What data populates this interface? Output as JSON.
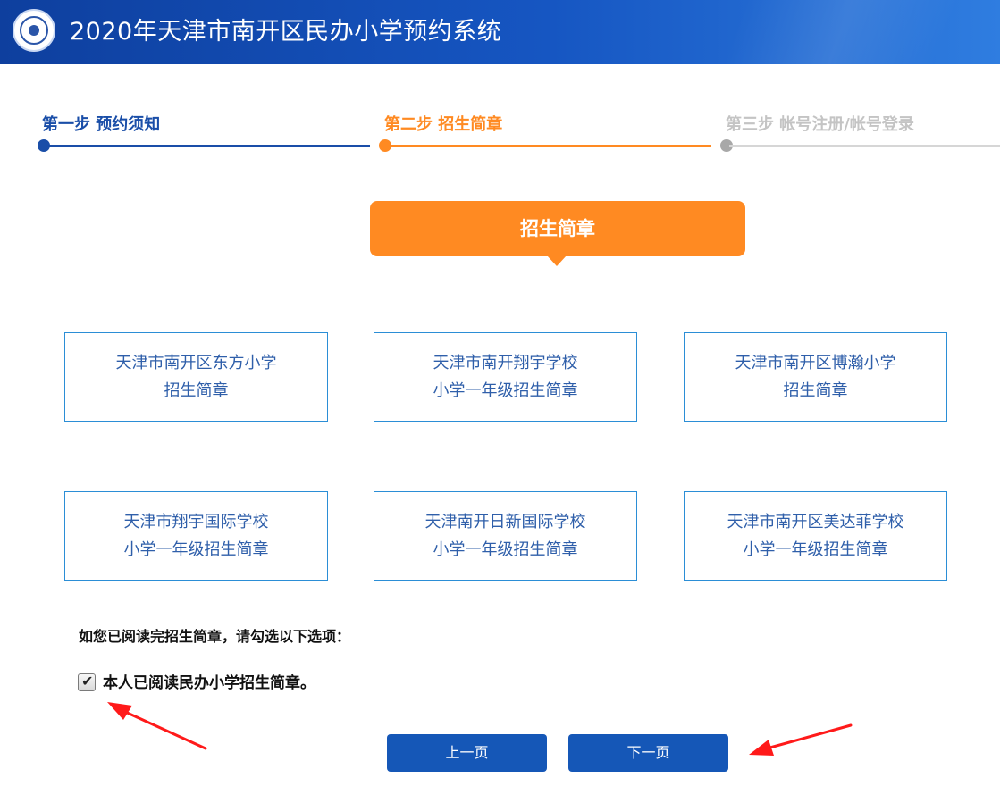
{
  "header": {
    "title": "2020年天津市南开区民办小学预约系统"
  },
  "steps": [
    {
      "label": "第一步 预约须知",
      "state": "done",
      "color": "#1a4ea8"
    },
    {
      "label": "第二步 招生简章",
      "state": "active",
      "color": "#ff8a22"
    },
    {
      "label": "第三步 帐号注册/帐号登录",
      "state": "pending",
      "color": "#c8c8c8"
    }
  ],
  "banner": {
    "title": "招生简章"
  },
  "cards": [
    {
      "line1": "天津市南开区东方小学",
      "line2": "招生简章"
    },
    {
      "line1": "天津市南开翔宇学校",
      "line2": "小学一年级招生简章"
    },
    {
      "line1": "天津市南开区博瀚小学",
      "line2": "招生简章"
    },
    {
      "line1": "天津市翔宇国际学校",
      "line2": "小学一年级招生简章"
    },
    {
      "line1": "天津南开日新国际学校",
      "line2": "小学一年级招生简章"
    },
    {
      "line1": "天津市南开区美达菲学校",
      "line2": "小学一年级招生简章"
    }
  ],
  "agreement": {
    "notice": "如您已阅读完招生简章，请勾选以下选项：",
    "checkbox_label": "本人已阅读民办小学招生简章。",
    "checked": true
  },
  "buttons": {
    "prev": "上一页",
    "next": "下一页"
  },
  "colors": {
    "header_blue": "#1656c2",
    "accent_orange": "#ff8a22",
    "button_blue": "#1557b7",
    "card_border": "#2b8ed6",
    "annotation_red": "#ff1a1a"
  }
}
